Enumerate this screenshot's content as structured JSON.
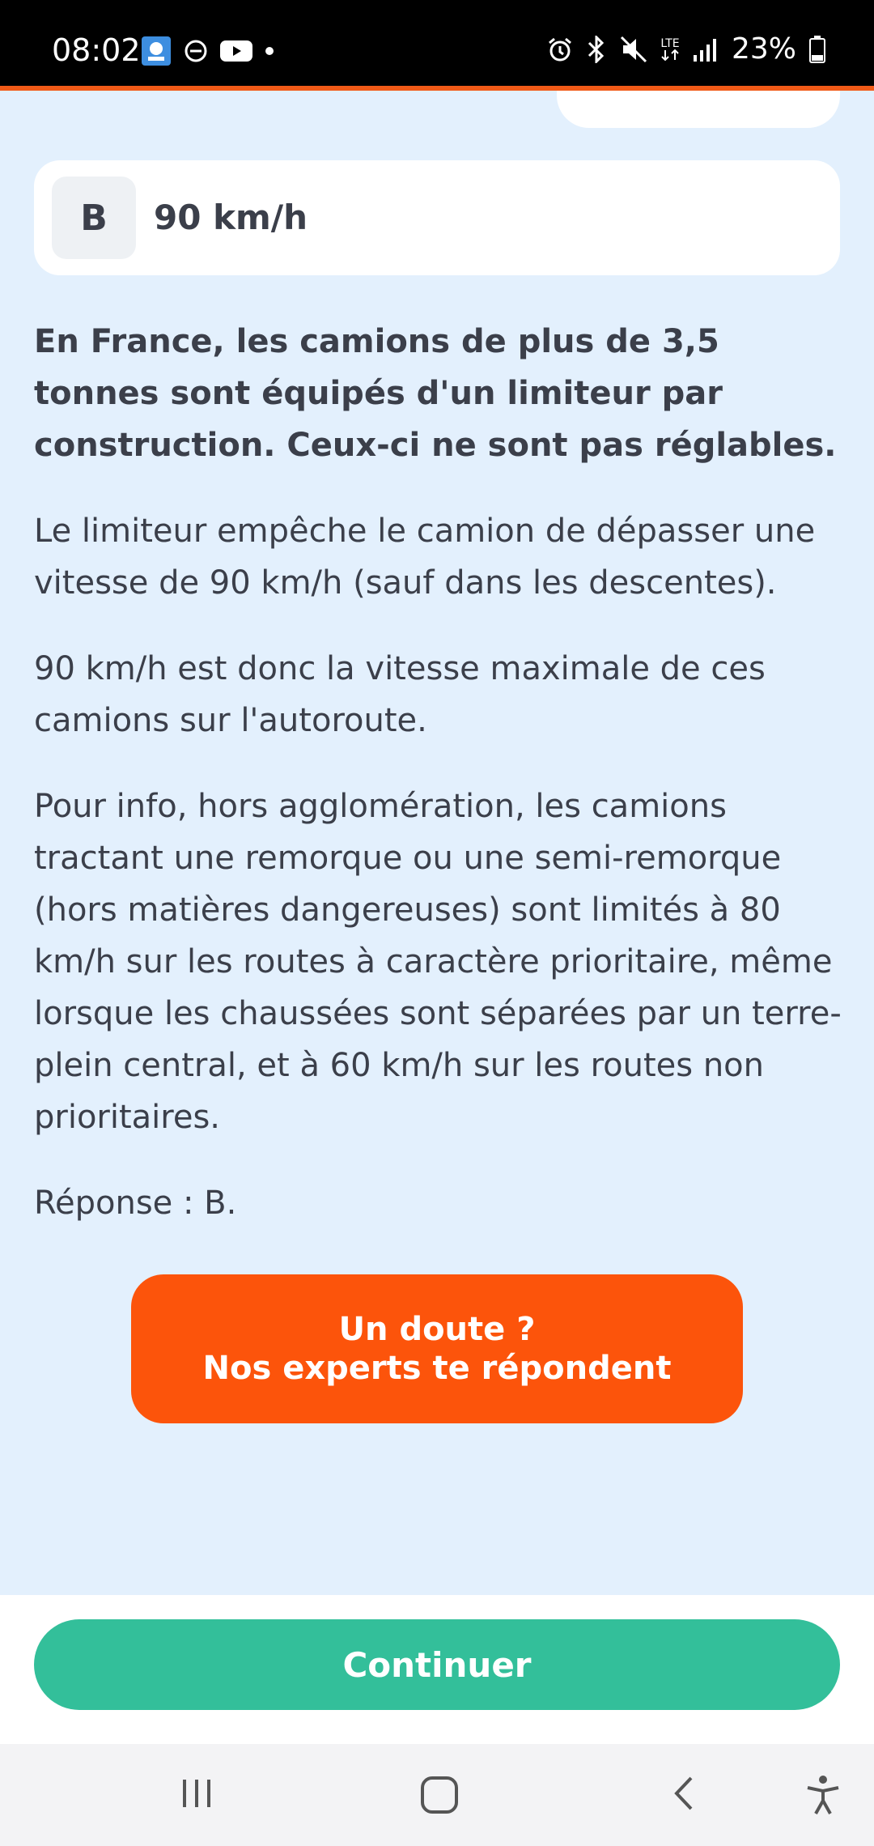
{
  "status_bar": {
    "time": "08:02",
    "battery": "23%",
    "left_icons": [
      "app-notification-icon",
      "do-not-disturb-icon",
      "youtube-icon",
      "dot-icon"
    ],
    "right_icons": [
      "alarm-icon",
      "bluetooth-icon",
      "mute-icon",
      "lte-icon",
      "signal-icon",
      "battery-icon"
    ],
    "lte_label": "LTE"
  },
  "answer": {
    "letter": "B",
    "text": "90 km/h"
  },
  "explanation": {
    "paragraphs": [
      "En France, les camions de plus de 3,5 tonnes sont équipés d'un limiteur par construction. Ceux-ci ne sont pas réglables.",
      "Le limiteur empêche le camion de dépasser une vitesse de 90 km/h (sauf dans les descentes).",
      "90 km/h est donc la vitesse maximale de ces camions sur l'autoroute.",
      "Pour info, hors agglomération, les camions tractant une remorque ou une semi-remorque (hors matières dangereuses) sont limités à 80 km/h sur les routes à caractère prioritaire, même lorsque les chaussées sont séparées par un terre-plein central, et à 60 km/h sur les routes non prioritaires.",
      "Réponse : B."
    ]
  },
  "expert_button": {
    "line1": "Un doute ?",
    "line2": "Nos experts te répondent"
  },
  "continue_button": {
    "label": "Continuer"
  },
  "nav": {
    "icons": [
      "recent-apps-icon",
      "home-icon",
      "back-icon",
      "accessibility-icon"
    ]
  },
  "colors": {
    "background": "#e3f0fd",
    "accent_orange": "#fc540b",
    "continue_green": "#33bf9a",
    "text": "#3b3f4a"
  }
}
